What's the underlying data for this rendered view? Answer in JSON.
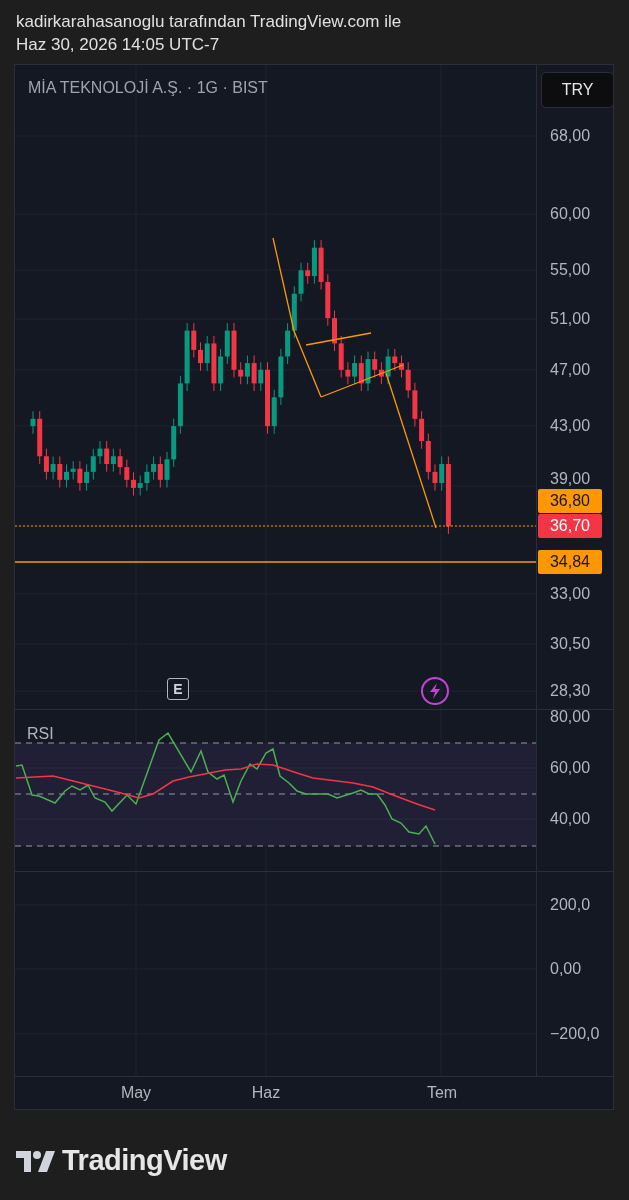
{
  "attribution": {
    "line": "kadirkarahasanoglu tarafından TradingView.com ile",
    "date": "Haz 30, 2026 14:05 UTC-7"
  },
  "chart": {
    "symbol": "MİA TEKNOLOJİ A.Ş. · 1G · BIST",
    "currency_button": "TRY",
    "price_axis": [
      "68,00",
      "60,00",
      "55,00",
      "51,00",
      "47,00",
      "43,00",
      "39,00",
      "33,00",
      "30,50",
      "28,30"
    ],
    "price_tags": [
      {
        "text": "36,80",
        "color": "#ff9800"
      },
      {
        "text": "36,70",
        "color": "#f23645"
      },
      {
        "text": "34,84",
        "color": "#ff9800"
      }
    ],
    "event_marker": "E"
  },
  "rsi": {
    "title": "RSI",
    "axis": [
      "80,00",
      "60,00",
      "40,00"
    ]
  },
  "oscillator": {
    "axis": [
      "200,0",
      "0,00",
      "−200,0"
    ]
  },
  "time_axis": [
    "May",
    "Haz",
    "Tem"
  ],
  "footer": {
    "logo_text": "TradingView"
  }
}
